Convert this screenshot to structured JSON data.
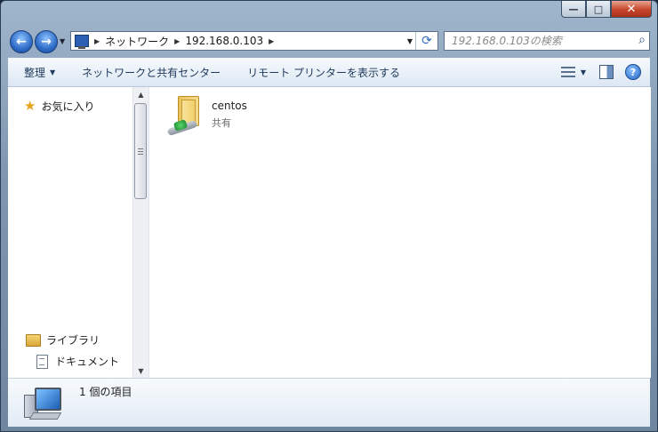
{
  "window": {
    "caption_buttons": {
      "minimize": "—",
      "maximize": "□",
      "close": "✕"
    }
  },
  "navigation": {
    "back_glyph": "←",
    "forward_glyph": "→",
    "breadcrumb": [
      "ネットワーク",
      "192.168.0.103"
    ],
    "search_placeholder": "192.168.0.103の検索"
  },
  "toolbar": {
    "organize": "整理",
    "network_center": "ネットワークと共有センター",
    "remote_printers": "リモート プリンターを表示する",
    "icons": [
      "views-icon",
      "preview-pane-icon",
      "help-icon"
    ]
  },
  "nav_pane": {
    "favorites": "お気に入り",
    "libraries": "ライブラリ",
    "documents": "ドキュメント"
  },
  "files": [
    {
      "name": "centos",
      "subtitle": "共有",
      "icon": "shared-folder-icon"
    }
  ],
  "details": {
    "status": "1 個の項目"
  },
  "colors": {
    "accent": "#2e6cc7",
    "toolbar_text": "#1e395b"
  }
}
